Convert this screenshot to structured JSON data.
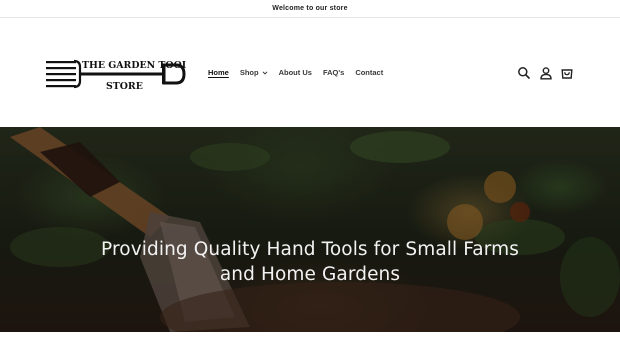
{
  "announcement": {
    "text": "Welcome to our store"
  },
  "header": {
    "logo": {
      "line1": "THE GARDEN TOOL",
      "line2": "STORE"
    },
    "nav": [
      {
        "label": "Home",
        "active": true
      },
      {
        "label": "Shop",
        "has_dropdown": true
      },
      {
        "label": "About Us"
      },
      {
        "label": "FAQ's"
      },
      {
        "label": "Contact"
      }
    ],
    "icons": [
      "search-icon",
      "account-icon",
      "cart-icon"
    ]
  },
  "hero": {
    "heading": "Providing Quality Hand Tools for Small Farms and Home Gardens"
  },
  "colors": {
    "text": "#121212",
    "hero_text": "#f2f2f2",
    "border": "#e6e6e6"
  }
}
